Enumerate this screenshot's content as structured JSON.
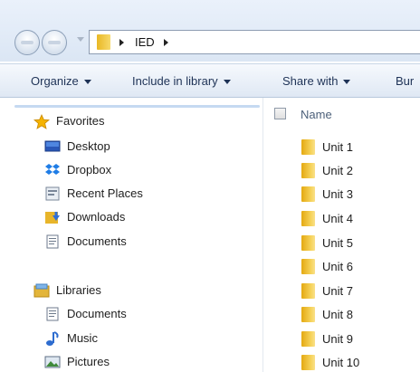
{
  "address": {
    "crumbs": [
      "IED"
    ]
  },
  "toolbar": {
    "organize": "Organize",
    "include_in_library": "Include in library",
    "share_with": "Share with",
    "burn": "Bur"
  },
  "nav": {
    "favorites": {
      "label": "Favorites",
      "items": [
        {
          "label": "Desktop",
          "icon": "desktop-icon"
        },
        {
          "label": "Dropbox",
          "icon": "dropbox-icon"
        },
        {
          "label": "Recent Places",
          "icon": "recent-places-icon"
        },
        {
          "label": "Downloads",
          "icon": "downloads-icon"
        },
        {
          "label": "Documents",
          "icon": "documents-icon"
        }
      ]
    },
    "libraries": {
      "label": "Libraries",
      "items": [
        {
          "label": "Documents",
          "icon": "documents-icon"
        },
        {
          "label": "Music",
          "icon": "music-icon"
        },
        {
          "label": "Pictures",
          "icon": "pictures-icon"
        }
      ]
    }
  },
  "file_list": {
    "column_name": "Name",
    "items": [
      "Unit 1",
      "Unit 2",
      "Unit 3",
      "Unit 4",
      "Unit 5",
      "Unit 6",
      "Unit 7",
      "Unit 8",
      "Unit 9",
      "Unit 10"
    ]
  },
  "colors": {
    "accent": "#1e3256",
    "folder": "#e9b824",
    "selection": "#c5d9f1"
  }
}
